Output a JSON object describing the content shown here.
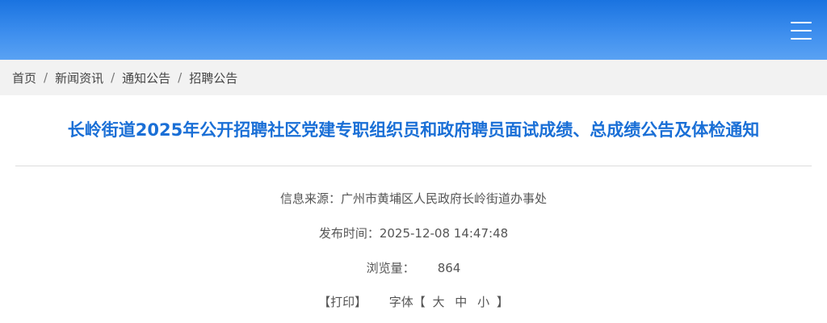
{
  "header": {
    "menu_icon": "hamburger-menu-icon",
    "background_color": "#2a7de6"
  },
  "breadcrumb": {
    "items": [
      "首页",
      "新闻资讯",
      "通知公告",
      "招聘公告"
    ],
    "separator": "/"
  },
  "article": {
    "title": "长岭街道2025年公开招聘社区党建专职组织员和政府聘员面试成绩、总成绩公告及体检通知",
    "title_color": "#1a6fd6",
    "source_label": "信息来源：",
    "source_value": "广州市黄埔区人民政府长岭街道办事处",
    "time_label": "发布时间：",
    "time_value": "2025-12-08 14:47:48",
    "views_label": "浏览量：",
    "views_value": "864",
    "print_label": "【打印】",
    "font_label": "字体【",
    "font_large": "大",
    "font_medium": "中",
    "font_small": "小",
    "font_close": "】"
  }
}
